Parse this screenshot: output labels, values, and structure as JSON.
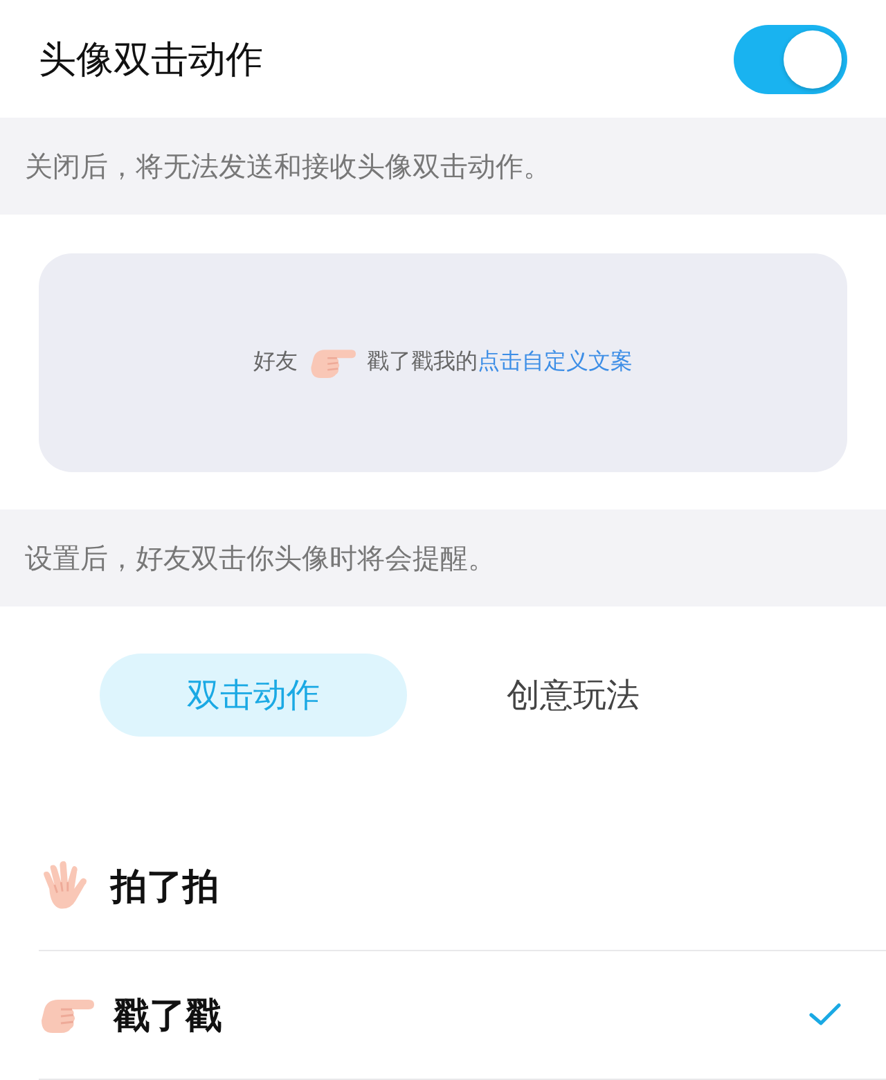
{
  "setting": {
    "title": "头像双击动作",
    "on": true
  },
  "toggle_hint": "关闭后，将无法发送和接收头像双击动作。",
  "preview": {
    "prefix": "好友",
    "suffix": "戳了戳我的",
    "link": "点击自定义文案"
  },
  "preview_hint": "设置后，好友双击你头像时将会提醒。",
  "tabs": [
    {
      "label": "双击动作",
      "selected": true
    },
    {
      "label": "创意玩法",
      "selected": false
    }
  ],
  "actions": [
    {
      "label": "拍了拍",
      "kind": "pat",
      "selected": false
    },
    {
      "label": "戳了戳",
      "kind": "poke",
      "selected": true
    }
  ]
}
